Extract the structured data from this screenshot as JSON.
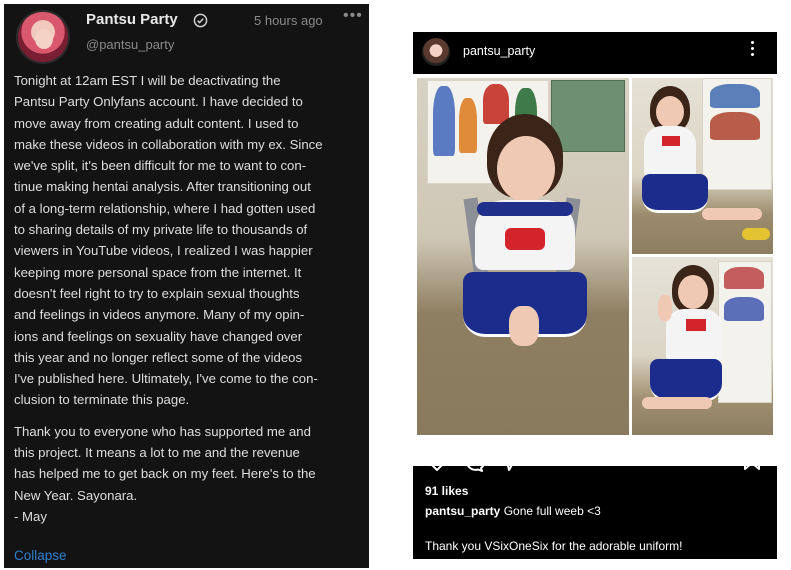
{
  "left_post": {
    "author": "Pantsu Party",
    "handle": "@pantsu_party",
    "time": "5 hours ago",
    "more": "•••",
    "paragraph1": "Tonight at 12am EST I will be deactivating the\nPantsu Party Onlyfans account. I have decided to\nmove away from creating adult content. I used to\nmake these videos in collaboration with my ex. Since\nwe've split, it's been difficult for me to want to con-\ntinue making hentai analysis. After transitioning out\nof a long-term relationship, where I had gotten used\nto sharing details of my private life to thousands of\nviewers in YouTube videos, I realized I was happier\nkeeping more personal space from the internet. It\ndoesn't feel right to try to explain sexual thoughts\nand feelings in videos anymore. Many of my opin-\nions and feelings on sexuality have changed over\nthis year and no longer reflect some of the videos\nI've published here. Ultimately, I've come to the con-\nclusion to terminate this page.",
    "paragraph2": "Thank you to everyone who has supported me and\nthis project. It means a lot to me and the revenue\nhas helped me to get back on my feet. Here's to the\nNew Year. Sayonara.\n- May",
    "collapse_label": "Collapse",
    "icons": {
      "verified": "verified-check-icon",
      "more": "more-dots-icon"
    }
  },
  "right_post": {
    "username": "pantsu_party",
    "likes": "91 likes",
    "caption_user": "pantsu_party",
    "caption_text": " Gone full weeb <3",
    "comment": "Thank you VSixOneSix for the adorable uniform!",
    "icons": {
      "menu": "kebab-menu-icon",
      "like": "heart-icon",
      "comment": "comment-bubble-icon",
      "share": "send-arrow-icon",
      "save": "bookmark-icon"
    }
  },
  "colors": {
    "left_bg": "#131313",
    "right_bg": "#000000",
    "link": "#2f7fd0",
    "uniform_blue": "#1c2c8c",
    "bow_red": "#d3242b"
  }
}
